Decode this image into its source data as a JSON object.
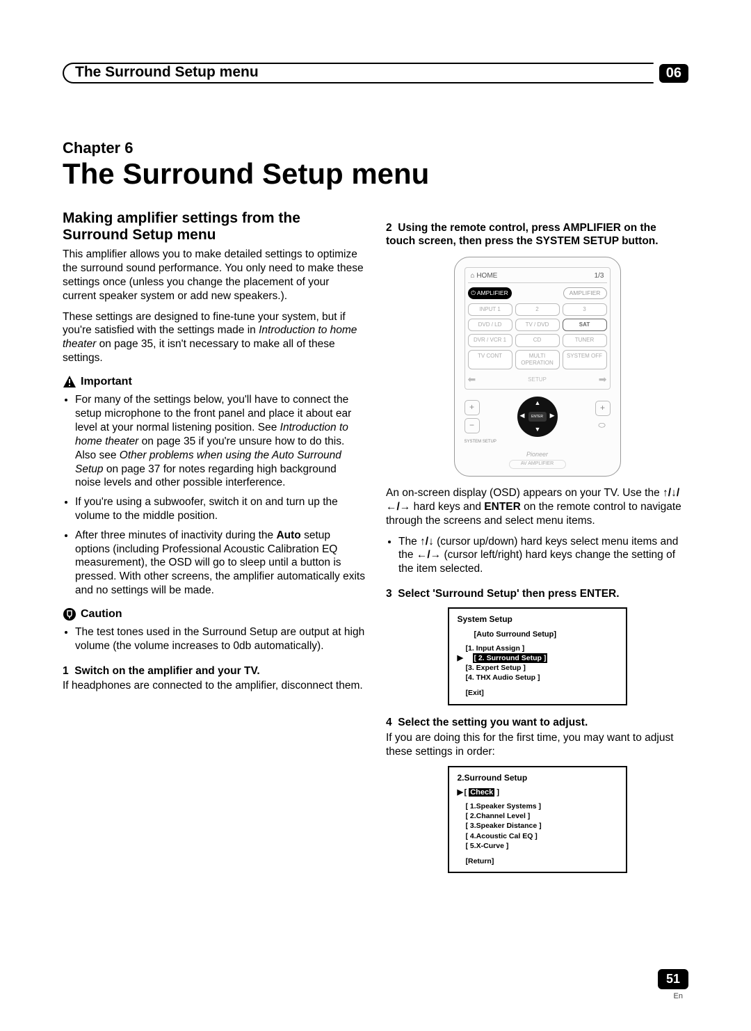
{
  "header": {
    "title": "The Surround Setup menu",
    "badge": "06"
  },
  "chapter": {
    "label": "Chapter 6",
    "title": "The Surround Setup menu"
  },
  "left": {
    "section_heading": "Making amplifier settings from the Surround Setup menu",
    "p1": "This amplifier allows you to make detailed settings to optimize the surround sound performance. You only need to make these settings once (unless you change the placement of your current speaker system or add new speakers.).",
    "p2a": "These settings are designed to fine-tune your system, but if you're satisfied with the settings made in ",
    "p2i": "Introduction to home theater",
    "p2b": " on page 35, it isn't necessary to make all of these settings.",
    "important_label": "Important",
    "imp_b1a": "For many of the settings below, you'll have to connect the setup microphone to the front panel and place it about ear level at your normal listening position. See ",
    "imp_b1i1": "Introduction to home theater",
    "imp_b1b": " on page 35 if you're unsure how to do this. Also see ",
    "imp_b1i2": "Other problems when using the Auto Surround Setup",
    "imp_b1c": " on page 37 for notes regarding high background noise levels and other possible interference.",
    "imp_b2": "If you're using a subwoofer, switch it on and turn up the volume to the middle position.",
    "imp_b3a": "After three minutes of inactivity during the ",
    "imp_b3bold": "Auto",
    "imp_b3b": " setup options (including Professional Acoustic Calibration EQ measurement), the OSD will go to sleep until a button is pressed. With other screens, the amplifier automatically exits and no settings will be made.",
    "caution_label": "Caution",
    "caution_b1": "The test tones used in the Surround Setup are output at high volume (the volume increases to 0db automatically).",
    "step1_num": "1",
    "step1_heading": "Switch on the amplifier and your TV.",
    "step1_body": "If headphones are connected to the amplifier, disconnect them."
  },
  "right": {
    "step2_num": "2",
    "step2_heading": "Using the remote control, press AMPLIFIER on the touch screen, then press the SYSTEM SETUP button.",
    "remote": {
      "home": "HOME",
      "page": "1/3",
      "amplifier": "AMPLIFIER",
      "amplifier2": "AMPLIFIER",
      "buttons": [
        "INPUT 1",
        "2",
        "3",
        "DVD / LD",
        "TV / DVD",
        "SAT",
        "DVR / VCR 1",
        "CD",
        "TUNER",
        "TV CONT",
        "MULTI OPERATION",
        "SYSTEM OFF"
      ],
      "setup": "SETUP",
      "enter": "ENTER",
      "system_setup": "SYSTEM SETUP",
      "logo": "Pioneer",
      "sublogo": "AV AMPLIFIER"
    },
    "p_osd_a": "An on-screen display (OSD) appears on your TV. Use the ",
    "p_osd_b": " hard keys and ",
    "p_osd_enter": "ENTER",
    "p_osd_c": " on the remote control to navigate through the screens and select menu items.",
    "sub_b1a": "The ",
    "sub_b1b": " (cursor up/down) hard keys select menu items and the ",
    "sub_b1c": " (cursor left/right) hard keys change the setting of the item selected.",
    "step3_num": "3",
    "step3_heading": "Select 'Surround Setup' then press ENTER.",
    "osd1": {
      "title": "System Setup",
      "sub": "[Auto Surround Setup]",
      "items": [
        "[1. Input Assign ]",
        "[ 2. Surround Setup ]",
        "[3. Expert Setup ]",
        "[4. THX Audio Setup ]"
      ],
      "selected_index": 1,
      "exit": "[Exit]"
    },
    "step4_num": "4",
    "step4_heading": "Select the setting you want to adjust.",
    "step4_body": "If you are doing this for the first time, you may want to adjust these settings in order:",
    "osd2": {
      "title": "2.Surround Setup",
      "check": "Check",
      "items": [
        "[ 1.Speaker Systems ]",
        "[ 2.Channel Level ]",
        "[ 3.Speaker Distance ]",
        "[ 4.Acoustic Cal EQ ]",
        "[ 5.X-Curve ]"
      ],
      "return": "[Return]"
    }
  },
  "footer": {
    "page": "51",
    "lang": "En"
  }
}
